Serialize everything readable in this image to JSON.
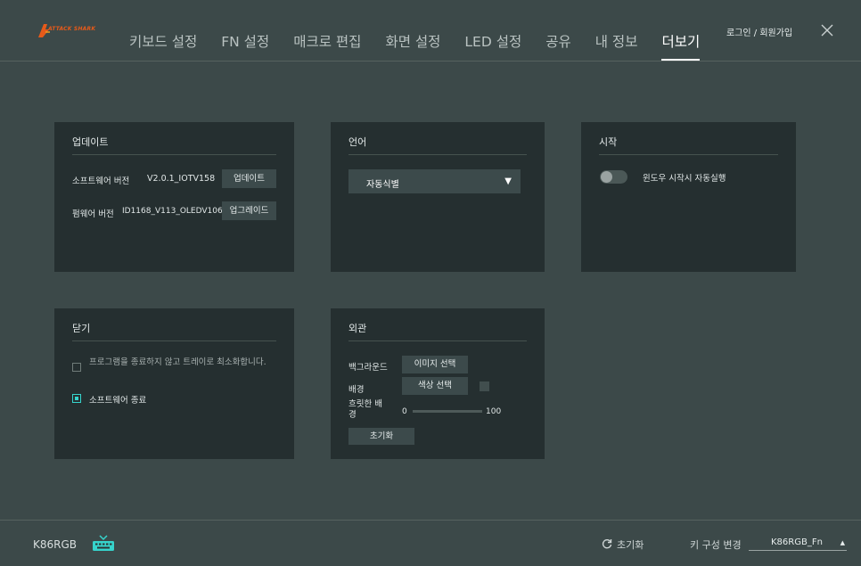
{
  "brand": {
    "logo_text": "ATTACK SHARK"
  },
  "nav": {
    "items": [
      {
        "label": "키보드 설정"
      },
      {
        "label": "FN 설정"
      },
      {
        "label": "매크로 편집"
      },
      {
        "label": "화면 설정"
      },
      {
        "label": "LED 설정"
      },
      {
        "label": "공유"
      },
      {
        "label": "내 정보"
      },
      {
        "label": "더보기"
      }
    ],
    "active": "더보기"
  },
  "header": {
    "login_label": "로그인 / 회원가입",
    "close_icon": "close-icon"
  },
  "update_panel": {
    "title": "업데이트",
    "software_label": "소프트웨어 버전",
    "software_version": "V2.0.1_IOTV158",
    "update_button": "업데이트",
    "firmware_label": "펌웨어 버전",
    "firmware_version": "ID1168_V113_OLEDV106",
    "upgrade_button": "업그레이드"
  },
  "language_panel": {
    "title": "언어",
    "selected": "자동식별",
    "arrow": "▼"
  },
  "startup_panel": {
    "title": "시작",
    "autostart_label": "윈도우 시작시 자동실행",
    "autostart_on": false
  },
  "close_panel": {
    "title": "닫기",
    "option_tray": "프로그램을 종료하지 않고 트레이로 최소화합니다.",
    "option_tray_checked": false,
    "option_exit": "소프트웨어 종료",
    "option_exit_checked": true
  },
  "appearance_panel": {
    "title": "외관",
    "background_label": "백그라운드",
    "image_button": "이미지 선택",
    "bg_label": "배경",
    "color_button": "색상 선택",
    "blur_label": "흐릿한 배경",
    "blur_min": "0",
    "blur_max": "100",
    "blur_value": 0,
    "reset_button": "초기화"
  },
  "footer": {
    "model": "K86RGB",
    "reset_label": "초기화",
    "keyconf_label": "키 구성 변경",
    "keyconf_value": "K86RGB_Fn",
    "keyconf_arrow": "▲"
  },
  "colors": {
    "background": "#3c4949",
    "panel": "#252f30",
    "button": "#3c4a4b",
    "accent": "#36d4cc",
    "logo": "#e65a1a"
  }
}
